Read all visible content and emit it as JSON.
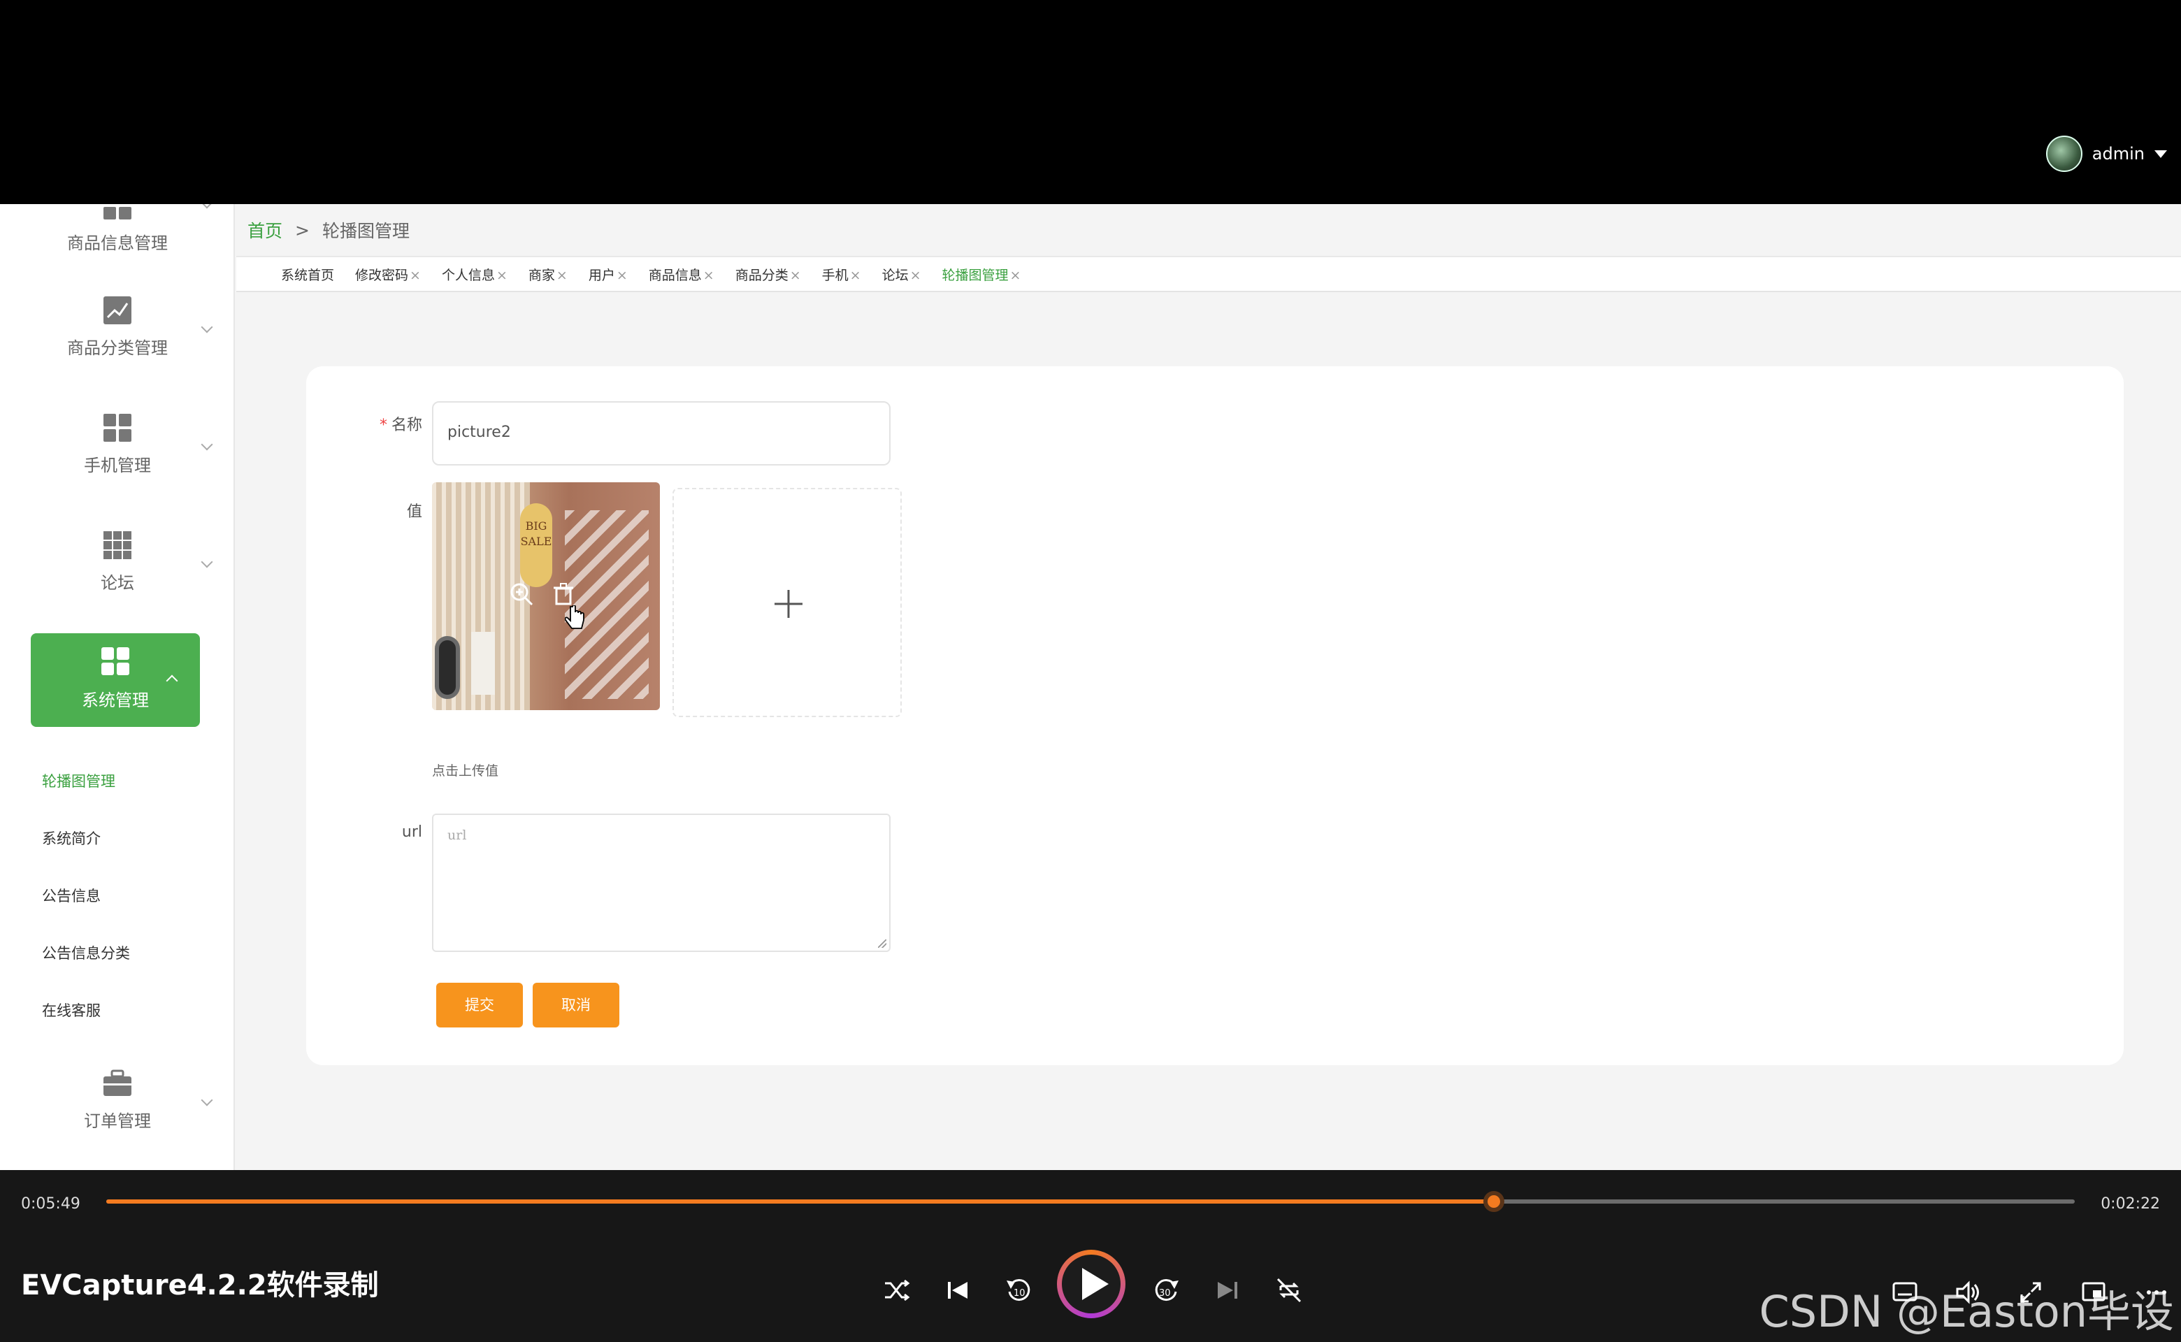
{
  "header": {
    "username": "admin"
  },
  "sidebar": {
    "groups": [
      {
        "label": "商品信息管理",
        "icon": "grid-icon"
      },
      {
        "label": "商品分类管理",
        "icon": "chart-icon"
      },
      {
        "label": "手机管理",
        "icon": "grid-icon"
      },
      {
        "label": "论坛",
        "icon": "table-icon"
      }
    ],
    "active_group": {
      "label": "系统管理",
      "icon": "grid-icon"
    },
    "sub_items": [
      "轮播图管理",
      "系统简介",
      "公告信息",
      "公告信息分类",
      "在线客服"
    ],
    "bottom_group": {
      "label": "订单管理",
      "icon": "briefcase-icon"
    }
  },
  "breadcrumb": {
    "home": "首页",
    "sep": ">",
    "current": "轮播图管理"
  },
  "tabs": [
    {
      "label": "系统首页",
      "closable": false
    },
    {
      "label": "修改密码",
      "closable": true
    },
    {
      "label": "个人信息",
      "closable": true
    },
    {
      "label": "商家",
      "closable": true
    },
    {
      "label": "用户",
      "closable": true
    },
    {
      "label": "商品信息",
      "closable": true
    },
    {
      "label": "商品分类",
      "closable": true
    },
    {
      "label": "手机",
      "closable": true
    },
    {
      "label": "论坛",
      "closable": true
    },
    {
      "label": "轮播图管理",
      "closable": true,
      "active": true
    }
  ],
  "tab_close_glyph": "×",
  "form": {
    "name_label": "名称",
    "name_required": "*",
    "name_value": "picture2",
    "value_label": "值",
    "image_badge": "BIG SALE",
    "upload_hint": "点击上传值",
    "url_label": "url",
    "url_placeholder": "url",
    "submit_label": "提交",
    "cancel_label": "取消"
  },
  "player": {
    "elapsed": "0:05:49",
    "remaining": "0:02:22",
    "progress_fraction": 0.705,
    "recorder_text": "EVCapture4.2.2软件录制",
    "watermark": "CSDN @Easton毕设"
  },
  "colors": {
    "accent": "#4caf50",
    "button": "#f7941d",
    "progress": "#f47b20"
  }
}
